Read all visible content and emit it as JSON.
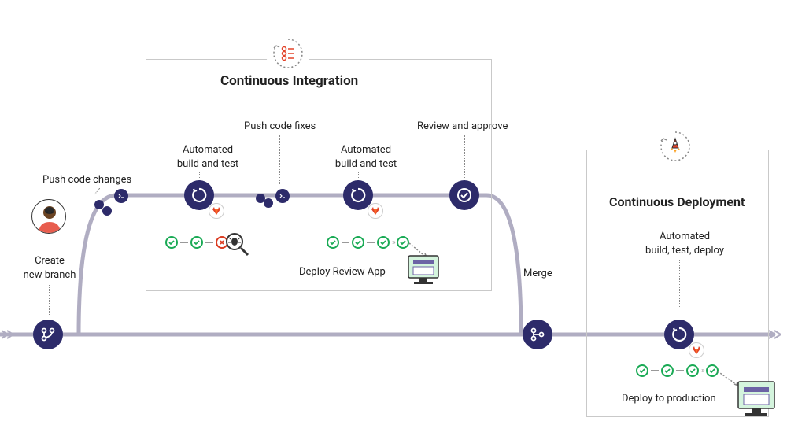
{
  "sections": {
    "ci_title": "Continuous Integration",
    "cd_title": "Continuous Deployment"
  },
  "steps": {
    "create_branch": "Create\nnew branch",
    "push_code_changes": "Push code changes",
    "automated_build_test_1": "Automated\nbuild and test",
    "push_code_fixes": "Push code fixes",
    "automated_build_test_2": "Automated\nbuild and test",
    "deploy_review_app": "Deploy Review App",
    "review_approve": "Review and approve",
    "merge": "Merge",
    "automated_build_test_deploy": "Automated\nbuild, test, deploy",
    "deploy_production": "Deploy to production"
  },
  "colors": {
    "node": "#2d2b6a",
    "path": "#b0adc2",
    "green": "#1aaa55",
    "red": "#db3b21"
  }
}
